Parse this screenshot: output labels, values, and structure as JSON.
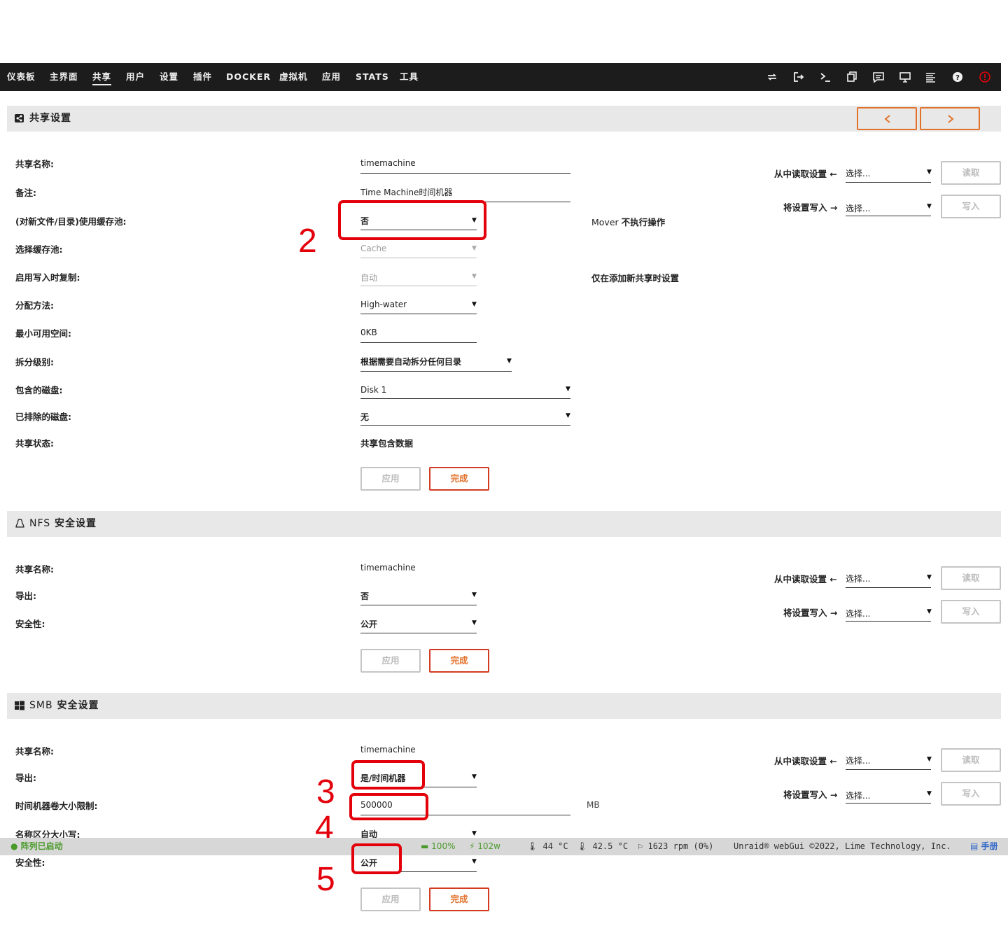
{
  "nav": {
    "items": [
      "仪表板",
      "主界面",
      "共享",
      "用户",
      "设置",
      "插件",
      "DOCKER",
      "虚拟机",
      "应用",
      "STATS",
      "工具"
    ],
    "active": "共享",
    "icons": [
      "sync-icon",
      "logout-icon",
      "terminal-icon",
      "copy-icon",
      "message-icon",
      "monitor-icon",
      "log-icon",
      "help-icon",
      "power-icon"
    ]
  },
  "share": {
    "header": "共享设置",
    "labels": {
      "name": "共享名称:",
      "comment": "备注:",
      "use_cache": "(对新文件/目录)使用缓存池:",
      "cache_pool": "选择缓存池:",
      "cow": "启用写入时复制:",
      "alloc": "分配方法:",
      "min_free": "最小可用空间:",
      "split": "拆分级别:",
      "include": "包含的磁盘:",
      "exclude": "已排除的磁盘:",
      "status": "共享状态:"
    },
    "values": {
      "name": "timemachine",
      "comment": "Time Machine时间机器",
      "use_cache": "否",
      "cache_pool": "Cache",
      "cow": "自动",
      "alloc": "High-water",
      "min_free": "0KB",
      "split": "根据需要自动拆分任何目录",
      "include": "Disk 1",
      "exclude": "无",
      "status": "共享包含数据"
    },
    "notes": {
      "mover_prefix": "Mover",
      "mover_text": "不执行操作",
      "cow_note": "仅在添加新共享时设置"
    }
  },
  "nfs": {
    "header_prefix": "NFS",
    "header_text": "安全设置",
    "labels": {
      "name": "共享名称:",
      "export": "导出:",
      "security": "安全性:"
    },
    "values": {
      "name": "timemachine",
      "export": "否",
      "security": "公开"
    }
  },
  "smb": {
    "header_prefix": "SMB",
    "header_text": "安全设置",
    "labels": {
      "name": "共享名称:",
      "export": "导出:",
      "tm_limit": "时间机器卷大小限制:",
      "case": "名称区分大小写:",
      "security": "安全性:"
    },
    "values": {
      "name": "timemachine",
      "export": "是/时间机器",
      "tm_limit": "500000",
      "tm_unit": "MB",
      "case": "自动",
      "security": "公开"
    }
  },
  "side": {
    "read_label": "从中读取设置",
    "write_label": "将设置写入",
    "select_placeholder": "选择...",
    "read_button": "读取",
    "write_button": "写入"
  },
  "buttons": {
    "apply": "应用",
    "done": "完成"
  },
  "annotations": [
    "2",
    "3",
    "4",
    "5"
  ],
  "footer": {
    "array_status": "阵列已启动",
    "battery": "100%",
    "power": "102w",
    "temp1": "44 °C",
    "temp2": "42.5 °C",
    "fan": "1623 rpm (0%)",
    "copyright": "Unraid® webGui ©2022, Lime Technology, Inc.",
    "manual": "手册"
  },
  "colors": {
    "accent": "#e2712a",
    "danger": "#d23b22",
    "annotation": "#e3000b",
    "nav_bg": "#1c1c1c"
  }
}
